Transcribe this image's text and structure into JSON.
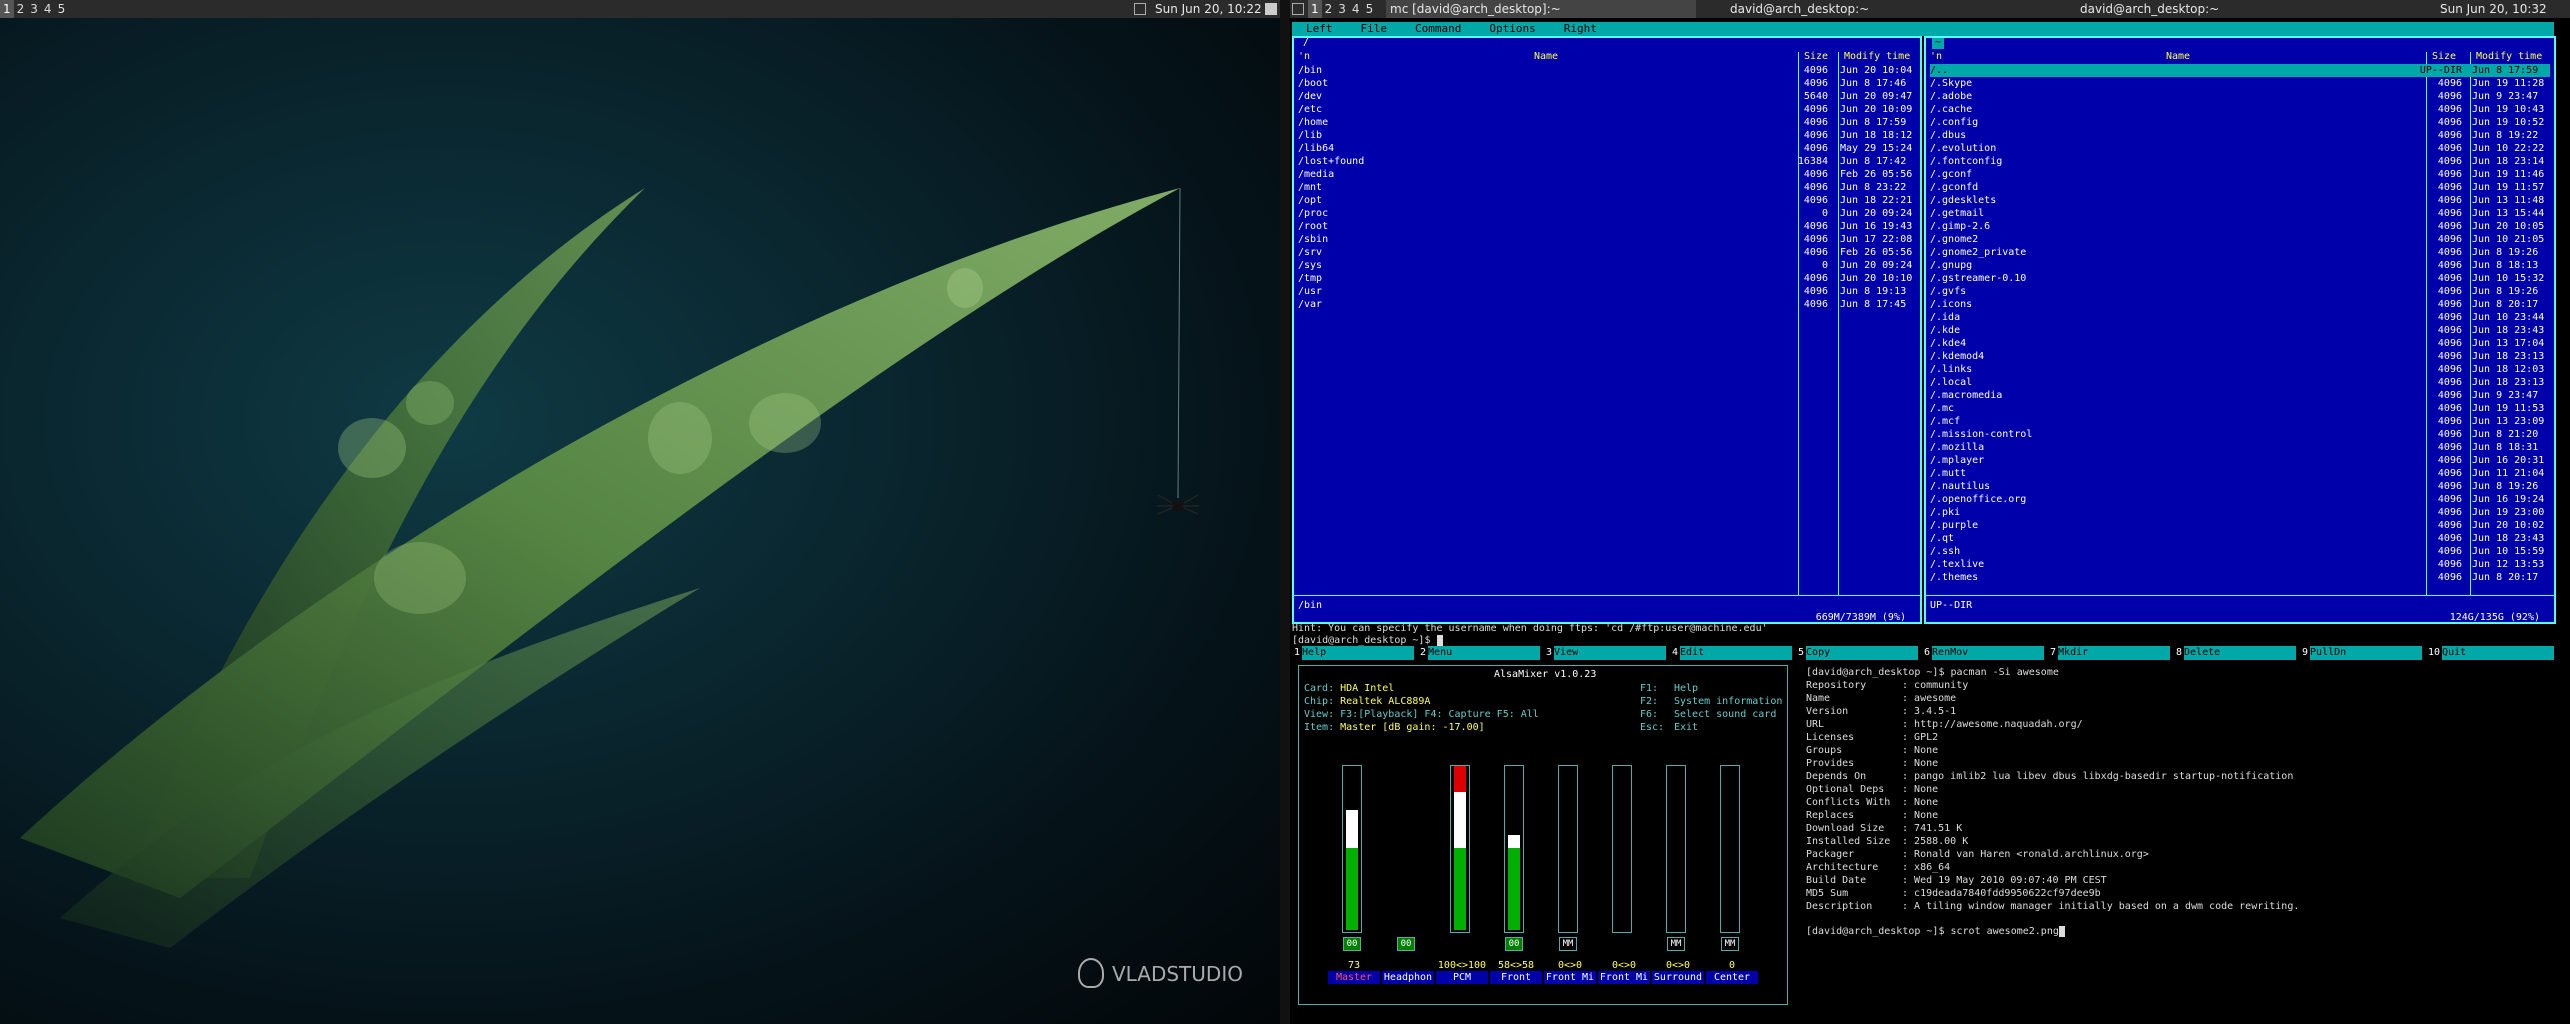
{
  "left_screen": {
    "tags": [
      "1",
      "2",
      "3",
      "4",
      "5"
    ],
    "clock": "Sun Jun 20, 10:22",
    "watermark": "VLADSTUDIO"
  },
  "right_screen": {
    "tags": [
      "1",
      "2",
      "3",
      "4",
      "5"
    ],
    "window_title": "mc [david@arch_desktop]:~",
    "title_2": "david@arch_desktop:~",
    "title_3": "david@arch_desktop:~",
    "clock": "Sun Jun 20, 10:32"
  },
  "mc": {
    "menu": [
      "Left",
      "File",
      "Command",
      "Options",
      "Right"
    ],
    "left_panel": {
      "path": "/",
      "headers": {
        "n": "'n",
        "name": "Name",
        "size": "Size",
        "time": "Modify time"
      },
      "rows": [
        [
          "/bin",
          "4096",
          "Jun 20 10:04"
        ],
        [
          "/boot",
          "4096",
          "Jun  8 17:46"
        ],
        [
          "/dev",
          "5640",
          "Jun 20 09:47"
        ],
        [
          "/etc",
          "4096",
          "Jun 20 10:09"
        ],
        [
          "/home",
          "4096",
          "Jun  8 17:59"
        ],
        [
          "/lib",
          "4096",
          "Jun 18 18:12"
        ],
        [
          "/lib64",
          "4096",
          "May 29 15:24"
        ],
        [
          "/lost+found",
          "16384",
          "Jun  8 17:42"
        ],
        [
          "/media",
          "4096",
          "Feb 26 05:56"
        ],
        [
          "/mnt",
          "4096",
          "Jun  8 23:22"
        ],
        [
          "/opt",
          "4096",
          "Jun 18 22:21"
        ],
        [
          "/proc",
          "0",
          "Jun 20 09:24"
        ],
        [
          "/root",
          "4096",
          "Jun 16 19:43"
        ],
        [
          "/sbin",
          "4096",
          "Jun 17 22:08"
        ],
        [
          "/srv",
          "4096",
          "Feb 26 05:56"
        ],
        [
          "/sys",
          "0",
          "Jun 20 09:24"
        ],
        [
          "/tmp",
          "4096",
          "Jun 20 10:10"
        ],
        [
          "/usr",
          "4096",
          "Jun  8 19:13"
        ],
        [
          "/var",
          "4096",
          "Jun  8 17:45"
        ]
      ],
      "status": "/bin",
      "disk": "669M/7389M (9%)"
    },
    "right_panel": {
      "path": "~",
      "headers": {
        "n": "'n",
        "name": "Name",
        "size": "Size",
        "time": "Modify time"
      },
      "rows": [
        [
          "/..",
          "UP--DIR",
          "Jun  8 17:59"
        ],
        [
          "/.Skype",
          "4096",
          "Jun 19 11:28"
        ],
        [
          "/.adobe",
          "4096",
          "Jun  9 23:47"
        ],
        [
          "/.cache",
          "4096",
          "Jun 19 10:43"
        ],
        [
          "/.config",
          "4096",
          "Jun 19 10:52"
        ],
        [
          "/.dbus",
          "4096",
          "Jun  8 19:22"
        ],
        [
          "/.evolution",
          "4096",
          "Jun 10 22:22"
        ],
        [
          "/.fontconfig",
          "4096",
          "Jun 18 23:14"
        ],
        [
          "/.gconf",
          "4096",
          "Jun 19 11:46"
        ],
        [
          "/.gconfd",
          "4096",
          "Jun 19 11:57"
        ],
        [
          "/.gdesklets",
          "4096",
          "Jun 13 11:48"
        ],
        [
          "/.getmail",
          "4096",
          "Jun 13 15:44"
        ],
        [
          "/.gimp-2.6",
          "4096",
          "Jun 20 10:05"
        ],
        [
          "/.gnome2",
          "4096",
          "Jun 10 21:05"
        ],
        [
          "/.gnome2_private",
          "4096",
          "Jun  8 19:26"
        ],
        [
          "/.gnupg",
          "4096",
          "Jun  8 18:13"
        ],
        [
          "/.gstreamer-0.10",
          "4096",
          "Jun 10 15:32"
        ],
        [
          "/.gvfs",
          "4096",
          "Jun  8 19:26"
        ],
        [
          "/.icons",
          "4096",
          "Jun  8 20:17"
        ],
        [
          "/.ida",
          "4096",
          "Jun 10 23:44"
        ],
        [
          "/.kde",
          "4096",
          "Jun 18 23:43"
        ],
        [
          "/.kde4",
          "4096",
          "Jun 13 17:04"
        ],
        [
          "/.kdemod4",
          "4096",
          "Jun 18 23:13"
        ],
        [
          "/.links",
          "4096",
          "Jun 18 12:03"
        ],
        [
          "/.local",
          "4096",
          "Jun 18 23:13"
        ],
        [
          "/.macromedia",
          "4096",
          "Jun  9 23:47"
        ],
        [
          "/.mc",
          "4096",
          "Jun 19 11:53"
        ],
        [
          "/.mcf",
          "4096",
          "Jun 13 23:09"
        ],
        [
          "/.mission-control",
          "4096",
          "Jun  8 21:20"
        ],
        [
          "/.mozilla",
          "4096",
          "Jun  8 18:31"
        ],
        [
          "/.mplayer",
          "4096",
          "Jun 16 20:31"
        ],
        [
          "/.mutt",
          "4096",
          "Jun 11 21:04"
        ],
        [
          "/.nautilus",
          "4096",
          "Jun  8 19:26"
        ],
        [
          "/.openoffice.org",
          "4096",
          "Jun 16 19:24"
        ],
        [
          "/.pki",
          "4096",
          "Jun 19 23:00"
        ],
        [
          "/.purple",
          "4096",
          "Jun 20 10:02"
        ],
        [
          "/.qt",
          "4096",
          "Jun 18 23:43"
        ],
        [
          "/.ssh",
          "4096",
          "Jun 10 15:59"
        ],
        [
          "/.texlive",
          "4096",
          "Jun 12 13:53"
        ],
        [
          "/.themes",
          "4096",
          "Jun  8 20:17"
        ]
      ],
      "status": "UP--DIR",
      "disk": "124G/135G (92%)"
    },
    "hint": "Hint: You can specify the username when doing ftps: 'cd /#ftp:user@machine.edu'",
    "prompt": "[david@arch_desktop ~]$ ",
    "fkeys": [
      [
        "1",
        "Help"
      ],
      [
        "2",
        "Menu"
      ],
      [
        "3",
        "View"
      ],
      [
        "4",
        "Edit"
      ],
      [
        "5",
        "Copy"
      ],
      [
        "6",
        "RenMov"
      ],
      [
        "7",
        "Mkdir"
      ],
      [
        "8",
        "Delete"
      ],
      [
        "9",
        "PullDn"
      ],
      [
        "10",
        "Quit"
      ]
    ]
  },
  "alsamixer": {
    "title": "AlsaMixer v1.0.23",
    "card_label": "Card:",
    "card": "HDA Intel",
    "chip_label": "Chip:",
    "chip": "Realtek ALC889A",
    "view_label": "View:",
    "view": "F3:[Playback] F4: Capture  F5: All",
    "item_label": "Item:",
    "item": "Master [dB gain: -17.00]",
    "help": [
      [
        "F1:",
        "Help"
      ],
      [
        "F2:",
        "System information"
      ],
      [
        "F6:",
        "Select sound card"
      ],
      [
        "Esc:",
        "Exit"
      ]
    ],
    "channels": [
      {
        "name": "Master",
        "value": "73",
        "level": 0.73,
        "red": 0,
        "mute": "00",
        "selected": true
      },
      {
        "name": "Headphon",
        "value": "",
        "level": 0,
        "red": 0,
        "mute": "00",
        "selected": false
      },
      {
        "name": "PCM",
        "value": "100<>100",
        "level": 1.0,
        "red": 0.16,
        "mute": "",
        "selected": false
      },
      {
        "name": "Front",
        "value": "58<>58",
        "level": 0.58,
        "red": 0,
        "mute": "00",
        "selected": false
      },
      {
        "name": "Front Mi",
        "value": "0<>0",
        "level": 0,
        "red": 0,
        "mute": "MM",
        "selected": false
      },
      {
        "name": "Front Mi",
        "value": "0<>0",
        "level": 0,
        "red": 0,
        "mute": "",
        "selected": false
      },
      {
        "name": "Surround",
        "value": "0<>0",
        "level": 0,
        "red": 0,
        "mute": "MM",
        "selected": false
      },
      {
        "name": "Center",
        "value": "0",
        "level": 0,
        "red": 0,
        "mute": "MM",
        "selected": false
      }
    ]
  },
  "terminal": {
    "command": "[david@arch_desktop ~]$ pacman -Si awesome",
    "fields": [
      [
        "Repository",
        "community"
      ],
      [
        "Name",
        "awesome"
      ],
      [
        "Version",
        "3.4.5-1"
      ],
      [
        "URL",
        "http://awesome.naquadah.org/"
      ],
      [
        "Licenses",
        "GPL2"
      ],
      [
        "Groups",
        "None"
      ],
      [
        "Provides",
        "None"
      ],
      [
        "Depends On",
        "pango  imlib2  lua  libev  dbus  libxdg-basedir  startup-notification"
      ],
      [
        "Optional Deps",
        "None"
      ],
      [
        "Conflicts With",
        "None"
      ],
      [
        "Replaces",
        "None"
      ],
      [
        "Download Size",
        "741.51 K"
      ],
      [
        "Installed Size",
        "2588.00 K"
      ],
      [
        "Packager",
        "Ronald van Haren <ronald.archlinux.org>"
      ],
      [
        "Architecture",
        "x86_64"
      ],
      [
        "Build Date",
        "Wed 19 May 2010 09:07:40 PM CEST"
      ],
      [
        "MD5 Sum",
        "c19deada7840fdd9950622cf97dee9b"
      ],
      [
        "Description",
        "A tiling window manager initially based on a dwm code rewriting."
      ]
    ],
    "last_command": "[david@arch_desktop ~]$ scrot awesome2.png"
  },
  "colors": {
    "mc_blue": "#0000aa",
    "mc_cyan": "#00a8a8",
    "mc_yellow": "#ffff55",
    "leaf_green": "#4f7f3a"
  }
}
